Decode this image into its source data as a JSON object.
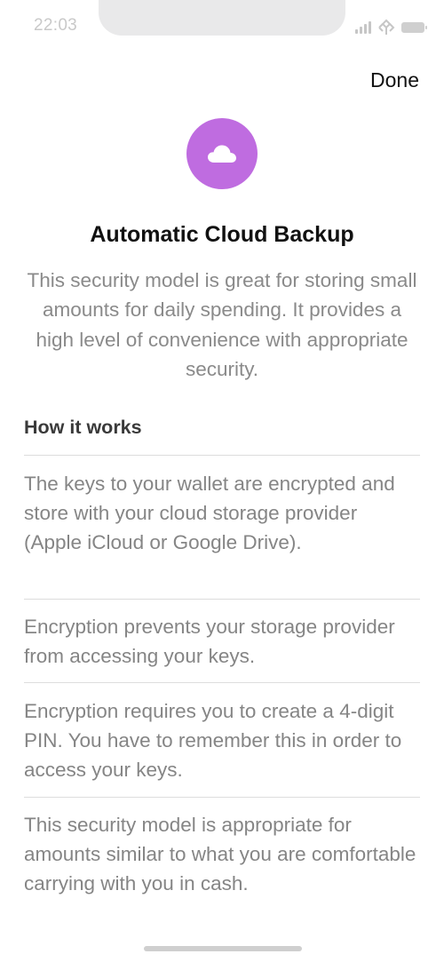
{
  "status_bar": {
    "time": "22:03"
  },
  "header": {
    "done_label": "Done"
  },
  "hero": {
    "icon": "cloud-icon",
    "accent": "#bf6ce0"
  },
  "title": "Automatic Cloud Backup",
  "intro": "This security model is great for storing small amounts for daily spending. It provides a high level of convenience with appropriate security.",
  "how_it_works": {
    "heading": "How it works",
    "items": [
      "The keys to your wallet are encrypted and store with your cloud storage provider (Apple iCloud or Google Drive).",
      "Encryption prevents your storage provider from accessing your keys.",
      "Encryption requires you to create a 4-digit PIN. You have to remember this in order to access your keys.",
      "This security model is appropriate for amounts similar to what you are comfortable carrying with you in cash."
    ]
  }
}
